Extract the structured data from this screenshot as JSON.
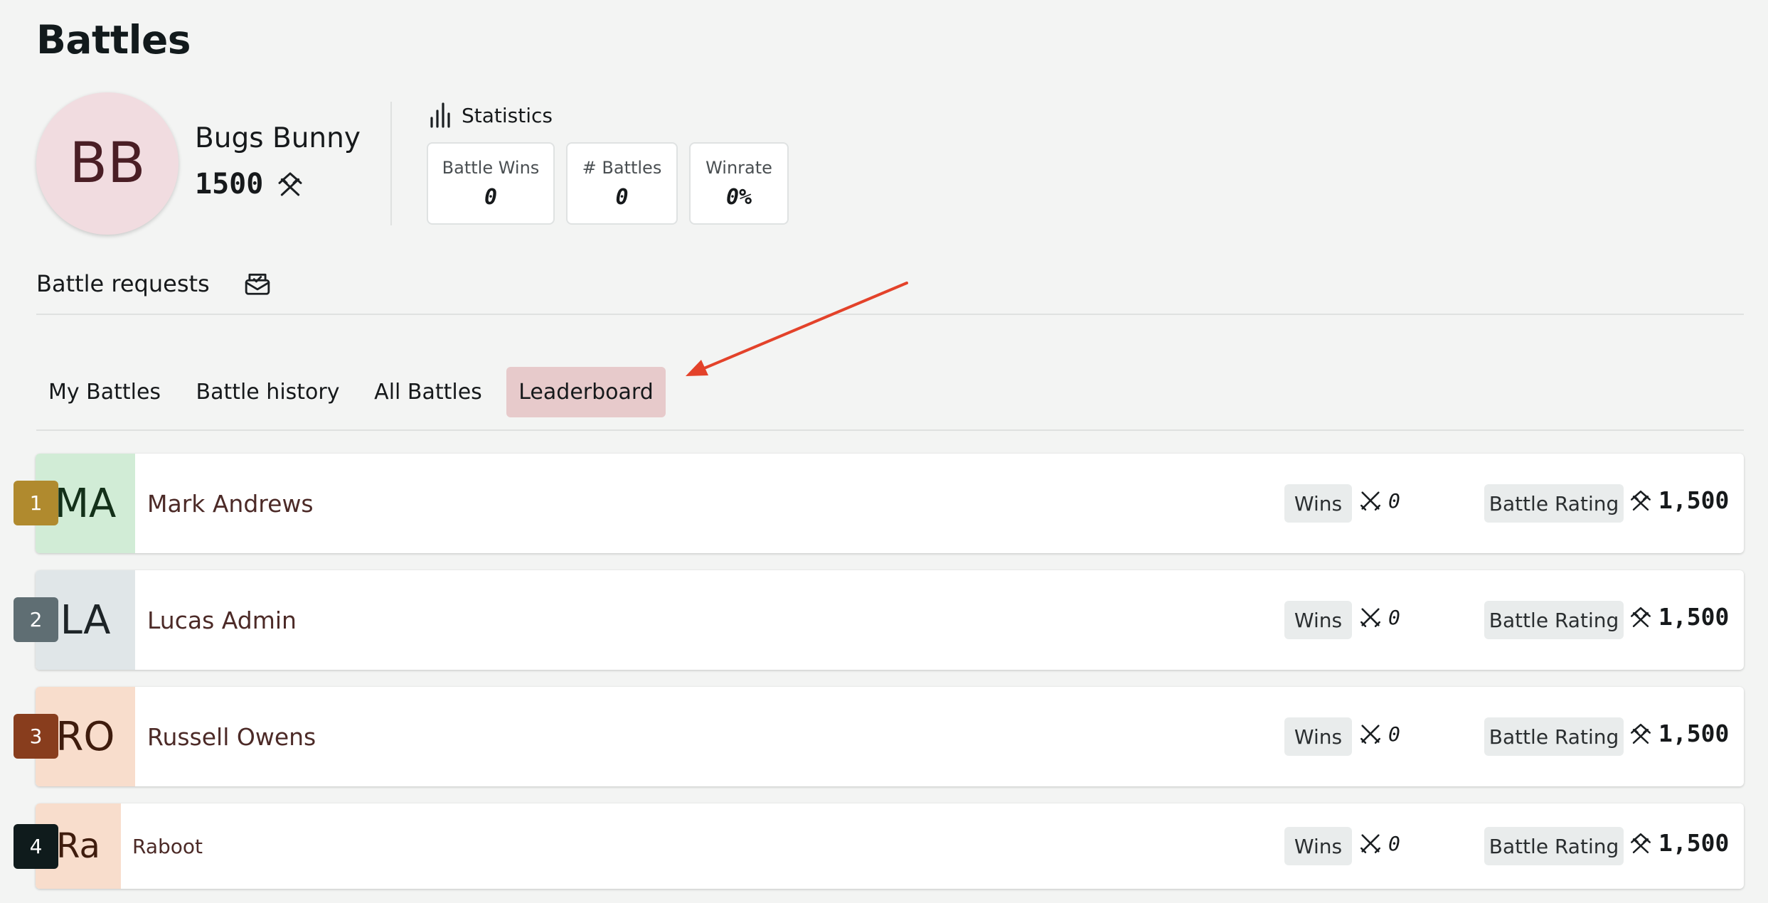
{
  "page": {
    "title": "Battles"
  },
  "profile": {
    "initials": "BB",
    "name": "Bugs Bunny",
    "rating": "1500",
    "rating_icon": "battle-rating-icon"
  },
  "statistics": {
    "title": "Statistics",
    "icon": "bar-chart-icon",
    "cards": [
      {
        "label": "Battle Wins",
        "value": "0"
      },
      {
        "label": "# Battles",
        "value": "0"
      },
      {
        "label": "Winrate",
        "value": "0%"
      }
    ]
  },
  "requests": {
    "label": "Battle requests",
    "icon": "mail-check-icon"
  },
  "tabs": [
    {
      "label": "My Battles",
      "active": false
    },
    {
      "label": "Battle history",
      "active": false
    },
    {
      "label": "All Battles",
      "active": false
    },
    {
      "label": "Leaderboard",
      "active": true
    }
  ],
  "leaderboard": {
    "wins_label": "Wins",
    "rating_label": "Battle Rating",
    "rows": [
      {
        "rank": "1",
        "initials": "MA",
        "name": "Mark Andrews",
        "wins": "0",
        "rating": "1,500",
        "avatar_color": "#d1ecd6",
        "badge_color": "#b08a2e"
      },
      {
        "rank": "2",
        "initials": "LA",
        "name": "Lucas Admin",
        "wins": "0",
        "rating": "1,500",
        "avatar_color": "#e0e6e8",
        "badge_color": "#5f6e73"
      },
      {
        "rank": "3",
        "initials": "RO",
        "name": "Russell Owens",
        "wins": "0",
        "rating": "1,500",
        "avatar_color": "#f8ddcc",
        "badge_color": "#883d1d"
      },
      {
        "rank": "4",
        "initials": "Ra",
        "name": "Raboot",
        "wins": "0",
        "rating": "1,500",
        "avatar_color": "#f8ddcc",
        "badge_color": "#0f1b1c"
      }
    ]
  },
  "colors": {
    "background": "#f3f4f3",
    "active_tab": "#e7cacb",
    "annotation_arrow": "#e3422a"
  }
}
